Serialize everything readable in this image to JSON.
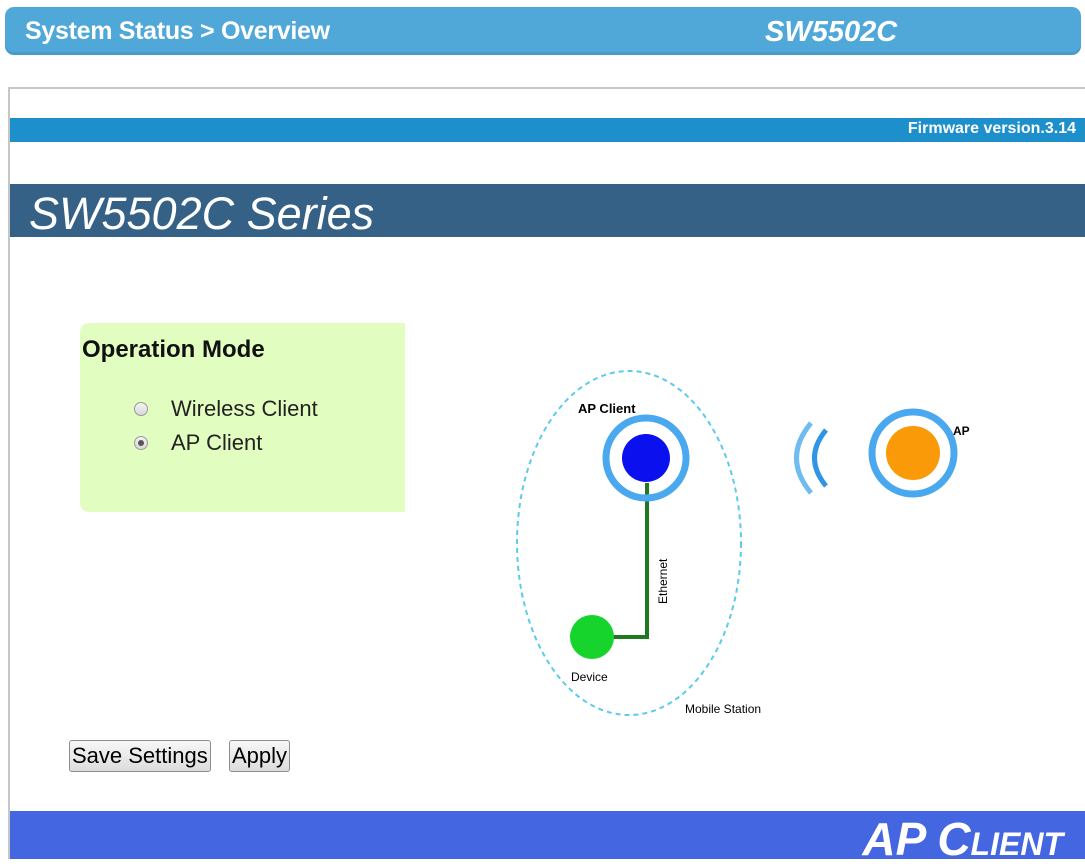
{
  "header": {
    "breadcrumb": "System Status > Overview",
    "model": "SW5502C"
  },
  "firmware": {
    "label": "Firmware version.3.14"
  },
  "series": {
    "title": "SW5502C Series"
  },
  "operation_mode": {
    "title": "Operation Mode",
    "options": [
      {
        "label": "Wireless Client",
        "selected": false
      },
      {
        "label": "AP Client",
        "selected": true
      }
    ]
  },
  "diagram": {
    "ap_client_label": "AP Client",
    "ethernet_label": "Ethernet",
    "device_label": "Device",
    "mobile_station_label": "Mobile Station",
    "ap_label": "AP",
    "colors": {
      "ap_client_node": "#0a10ee",
      "ring": "#4aa8ee",
      "device_node": "#16d42c",
      "ethernet_line": "#1f7a1f",
      "ap_node": "#fa9a08",
      "dashed_boundary": "#5ccbea"
    }
  },
  "buttons": {
    "save": "Save Settings",
    "apply": "Apply"
  },
  "footer": {
    "mode": "AP Client"
  },
  "colors": {
    "topbar": "#4fa8d8",
    "firmware_bar": "#1d8fcb",
    "series_bar": "#356187",
    "op_box": "#e2fdc0",
    "footer": "#4466e0"
  }
}
